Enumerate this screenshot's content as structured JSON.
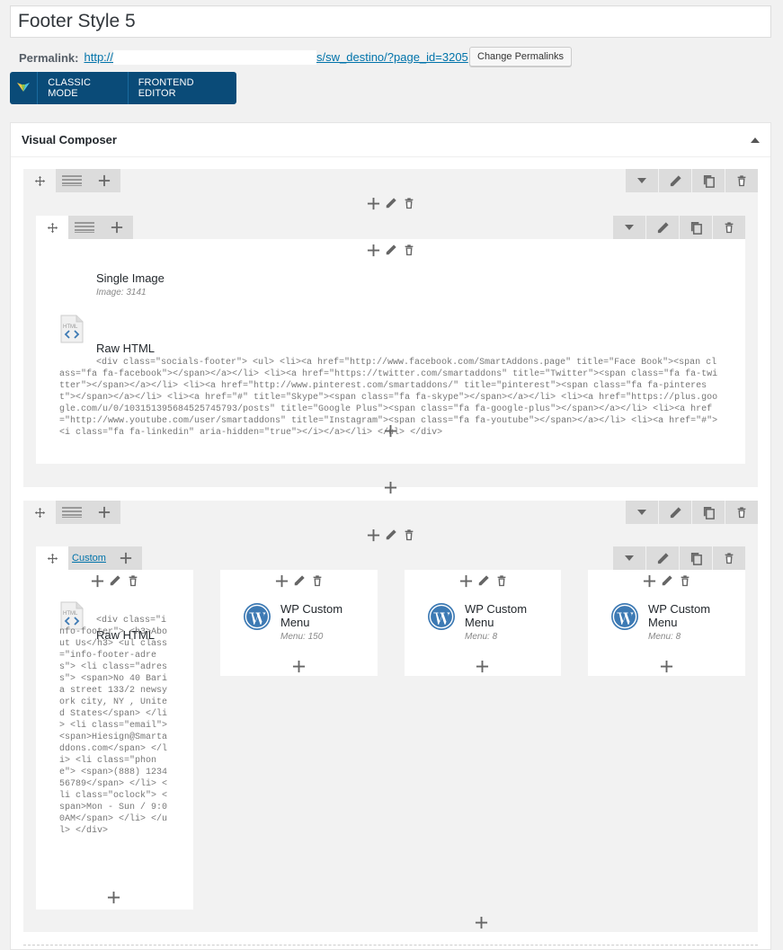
{
  "post": {
    "title": "Footer Style 5",
    "permalink_label": "Permalink:",
    "permalink_start": "http://",
    "permalink_end": "s/sw_destino/?page_id=3205",
    "change_permalinks": "Change Permalinks"
  },
  "modes": {
    "classic": "CLASSIC MODE",
    "frontend": "FRONTEND EDITOR"
  },
  "panel": {
    "title": "Visual Composer"
  },
  "row1": {
    "single_image": {
      "title": "Single Image",
      "sub": "Image: 3141"
    },
    "raw_html": {
      "title": "Raw HTML",
      "code": "<div class=\"socials-footer\"> <ul> <li><a href=\"http://www.facebook.com/SmartAddons.page\" title=\"Face Book\"><span class=\"fa fa-facebook\"></span></a></li> <li><a href=\"https://twitter.com/smartaddons\" title=\"Twitter\"><span class=\"fa fa-twitter\"></span></a></li> <li><a href=\"http://www.pinterest.com/smartaddons/\" title=\"pinterest\"><span class=\"fa fa-pinterest\"></span></a></li> <li><a href=\"#\" title=\"Skype\"><span class=\"fa fa-skype\"></span></a></li> <li><a href=\"https://plus.google.com/u/0/103151395684525745793/posts\" title=\"Google Plus\"><span class=\"fa fa-google-plus\"></span></a></li> <li><a href=\"http://www.youtube.com/user/smartaddons\" title=\"Instagram\"><span class=\"fa fa-youtube\"></span></a></li> <li><a href=\"#\"><i class=\"fa fa-linkedin\" aria-hidden=\"true\"></i></a></li> </ul> </div>"
    }
  },
  "row2": {
    "tab_label": "Custom",
    "col1": {
      "title": "Raw HTML",
      "code": "<div class=\"info-footer\"> <h3>About Us</h3> <ul class=\"info-footer-adres\"> <li class=\"adress\"> <span>No 40 Baria street 133/2 newsyork city, NY , United States</span> </li> <li class=\"email\"> <span>Hiesign@Smartaddons.com</span> </li> <li class=\"phone\"> <span>(888) 1234 56789</span> </li> <li class=\"oclock\"> <span>Mon - Sun / 9:00AM</span> </li> </ul> </div>"
    },
    "col2": {
      "title": "WP Custom Menu",
      "sub": "Menu: 150"
    },
    "col3": {
      "title": "WP Custom Menu",
      "sub": "Menu: 8"
    },
    "col4": {
      "title": "WP Custom Menu",
      "sub": "Menu: 8"
    }
  },
  "icons": {
    "move": "move-icon",
    "layout": "layout-icon",
    "add": "plus-icon",
    "edit": "pencil-icon",
    "clone": "clone-icon",
    "delete": "trash-icon",
    "toggle": "chevron-down-icon",
    "html": "html-icon",
    "wordpress": "wordpress-icon"
  }
}
